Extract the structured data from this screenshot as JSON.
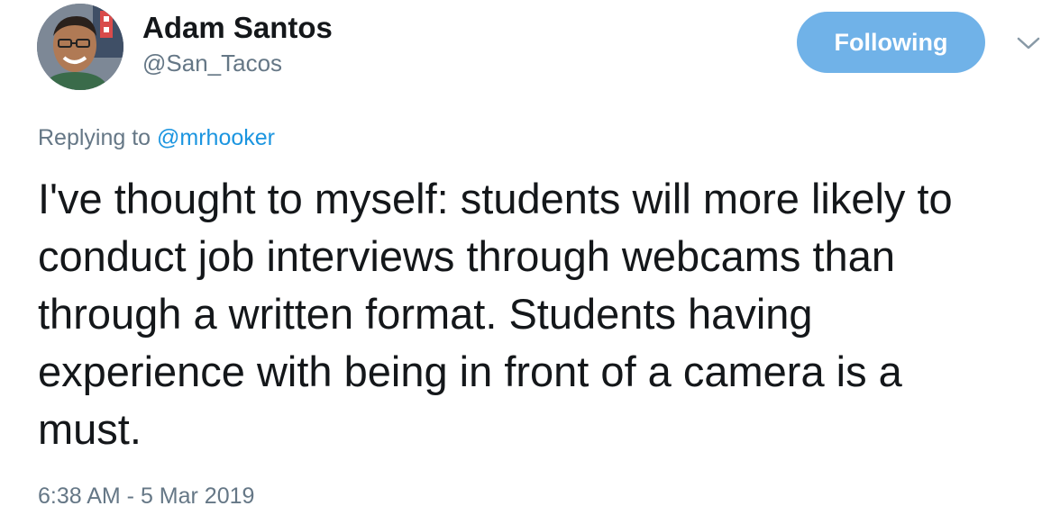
{
  "author": {
    "display_name": "Adam Santos",
    "handle": "@San_Tacos"
  },
  "follow_button": {
    "label": "Following",
    "color": "#70b2e8"
  },
  "more_menu": {
    "icon": "chevron-down-icon"
  },
  "reply": {
    "prefix": "Replying to",
    "mention": "@mrhooker"
  },
  "tweet": {
    "text": "I've thought to myself: students will more likely to conduct job interviews through webcams than through a written format. Students having experience with being in front of a camera is a must.",
    "timestamp": "6:38 AM - 5 Mar 2019"
  },
  "colors": {
    "text_primary": "#14171a",
    "text_secondary": "#657786",
    "link": "#1b95e0"
  }
}
